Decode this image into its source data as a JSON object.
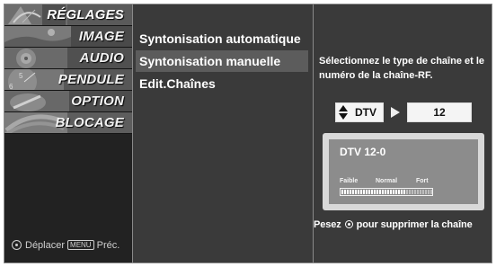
{
  "sidebar": {
    "items": [
      {
        "label": "RÉGLAGES",
        "icon": "satellite-dish-icon"
      },
      {
        "label": "IMAGE",
        "icon": "landscape-photo-icon"
      },
      {
        "label": "AUDIO",
        "icon": "speaker-icon"
      },
      {
        "label": "PENDULE",
        "icon": "clock-icon"
      },
      {
        "label": "OPTION",
        "icon": "option-tag-icon"
      },
      {
        "label": "BLOCAGE",
        "icon": "lock-icon"
      }
    ],
    "active_index": 0,
    "footer": {
      "move_label": "Déplacer",
      "menu_key": "MENU",
      "back_label": "Préc."
    }
  },
  "submenu": {
    "items": [
      {
        "label": "Syntonisation automatique"
      },
      {
        "label": "Syntonisation manuelle"
      },
      {
        "label": "Edit.Chaînes"
      }
    ],
    "active_index": 1
  },
  "panel": {
    "description": "Sélectionnez le type de chaîne et le numéro de la chaîne-RF.",
    "channel_type": "DTV",
    "channel_number": "12",
    "preview": {
      "title": "DTV 12-0",
      "levels": [
        "Faible",
        "Normal",
        "Fort"
      ],
      "signal_fraction": 0.72
    },
    "hint_prefix": "Pesez",
    "hint_suffix": "pour supprimer la chaîne"
  },
  "colors": {
    "background": "#3a3a3a",
    "highlight": "#5c5c5c",
    "text": "#ffffff"
  }
}
